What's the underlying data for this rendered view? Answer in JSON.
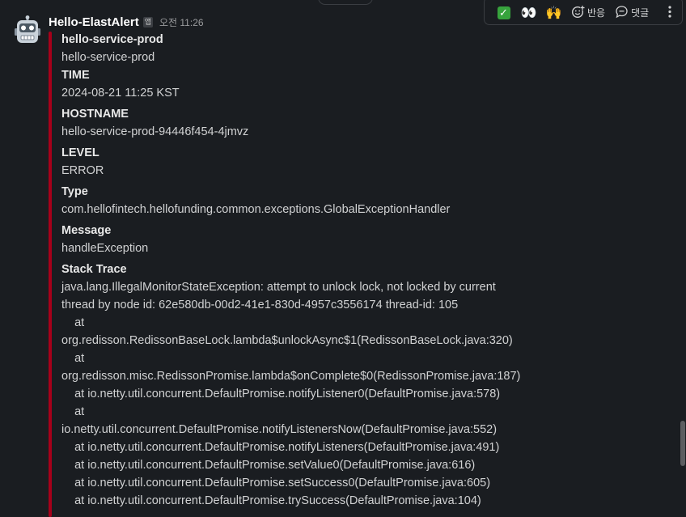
{
  "message": {
    "sender": "Hello-ElastAlert",
    "app_badge": "앱",
    "timestamp": "오전 11:26",
    "avatar_icon": "robot-icon",
    "accent_color": "#a6001a"
  },
  "toolbar": {
    "reactions": [
      {
        "icon": "check-mark-icon",
        "glyph": "✓"
      },
      {
        "icon": "eyes-icon",
        "glyph": "👀"
      },
      {
        "icon": "raised-hands-icon",
        "glyph": "🙌"
      }
    ],
    "react_label": "반응",
    "reply_label": "댓글",
    "more_icon": "more-vertical-icon"
  },
  "attachment": {
    "fields": [
      {
        "title": "hello-service-prod",
        "value": "hello-service-prod"
      },
      {
        "title": "TIME",
        "value": "2024-08-21 11:25 KST"
      },
      {
        "title": "HOSTNAME",
        "value": "hello-service-prod-94446f454-4jmvz"
      },
      {
        "title": "LEVEL",
        "value": "ERROR"
      },
      {
        "title": "Type",
        "value": "com.hellofintech.hellofunding.common.exceptions.GlobalExceptionHandler"
      },
      {
        "title": "Message",
        "value": "handleException"
      }
    ],
    "stack_trace_title": "Stack Trace",
    "stack_trace_lines": [
      "java.lang.IllegalMonitorStateException: attempt to unlock lock, not locked by current",
      "thread by node id: 62e580db-00d2-41e1-830d-4957c3556174 thread-id: 105",
      "    at",
      "org.redisson.RedissonBaseLock.lambda$unlockAsync$1(RedissonBaseLock.java:320)",
      "    at",
      "org.redisson.misc.RedissonPromise.lambda$onComplete$0(RedissonPromise.java:187)",
      "    at io.netty.util.concurrent.DefaultPromise.notifyListener0(DefaultPromise.java:578)",
      "    at",
      "io.netty.util.concurrent.DefaultPromise.notifyListenersNow(DefaultPromise.java:552)",
      "    at io.netty.util.concurrent.DefaultPromise.notifyListeners(DefaultPromise.java:491)",
      "    at io.netty.util.concurrent.DefaultPromise.setValue0(DefaultPromise.java:616)",
      "    at io.netty.util.concurrent.DefaultPromise.setSuccess0(DefaultPromise.java:605)",
      "    at io.netty.util.concurrent.DefaultPromise.trySuccess(DefaultPromise.java:104)"
    ]
  }
}
